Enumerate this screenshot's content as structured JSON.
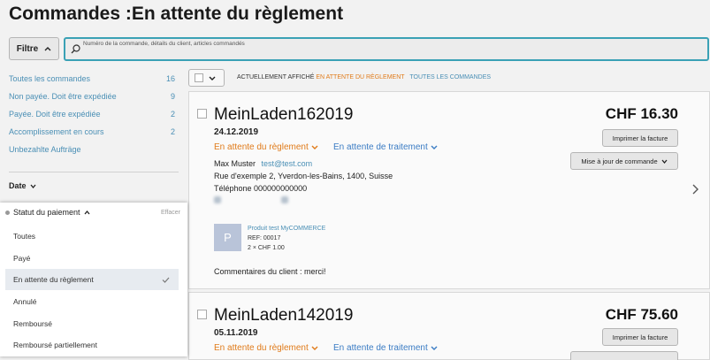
{
  "page": {
    "title": "Commandes :En attente du règlement"
  },
  "filter": {
    "label": "Filtre"
  },
  "search": {
    "placeholder": "Numéro de la commande, détails du client, articles commandés"
  },
  "sidebar": {
    "items": [
      {
        "label": "Toutes les commandes",
        "count": "16"
      },
      {
        "label": "Non payée. Doit être expédiée",
        "count": "9"
      },
      {
        "label": "Payée. Doit être expédiée",
        "count": "2"
      },
      {
        "label": "Accomplissement en cours",
        "count": "2"
      },
      {
        "label": "Unbezahlte Aufträge",
        "count": ""
      }
    ],
    "date_label": "Date"
  },
  "payment_filter": {
    "title": "Statut du paiement",
    "clear": "Effacer",
    "options": [
      "Toutes",
      "Payé",
      "En attente du règlement",
      "Annulé",
      "Remboursé",
      "Remboursé partiellement"
    ],
    "selected_index": 2
  },
  "listing": {
    "prefix": "ACTUELLEMENT AFFICHÉ",
    "current": "EN ATTENTE DU RÈGLEMENT",
    "all_link": "TOUTES LES COMMANDES"
  },
  "orders": [
    {
      "id": "MeinLaden162019",
      "date": "24.12.2019",
      "price": "CHF 16.30",
      "payment_status": "En attente du règlement",
      "fulfillment_status": "En attente de traitement",
      "print_label": "Imprimer la facture",
      "update_label": "Mise à jour de commande",
      "customer_name": "Max Muster",
      "customer_email": "test@test.com",
      "address": "Rue d'exemple 2, Yverdon-les-Bains, 1400, Suisse",
      "phone": "Téléphone 000000000000",
      "product": {
        "thumb_letter": "P",
        "name": "Produit test MyCOMMERCE",
        "ref": "REF: 00017",
        "qty": "2 × CHF 1.00"
      },
      "comment": "Commentaires du client : merci!"
    },
    {
      "id": "MeinLaden142019",
      "date": "05.11.2019",
      "price": "CHF 75.60",
      "payment_status": "En attente du règlement",
      "fulfillment_status": "En attente de traitement",
      "print_label": "Imprimer la facture"
    }
  ],
  "colors": {
    "accent": "#3aa1b5",
    "orange": "#e07b1a",
    "blue": "#3b7cc4",
    "link": "#4a8fb5"
  },
  "icons": [
    "search-icon",
    "chevron-up-icon",
    "chevron-down-icon",
    "checkmark-icon",
    "chevron-right-icon"
  ]
}
